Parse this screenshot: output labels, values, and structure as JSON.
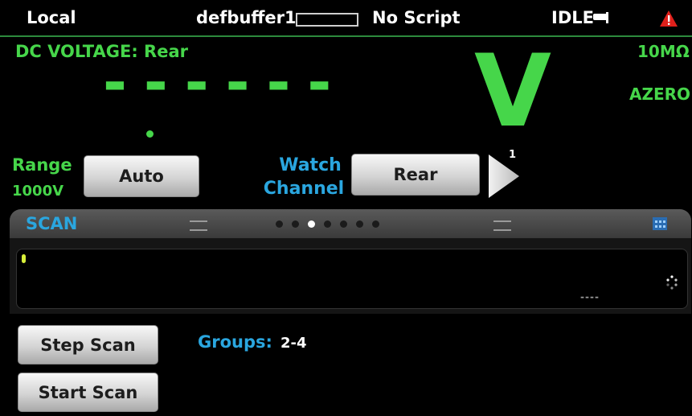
{
  "status_bar": {
    "location": "Local",
    "buffer": "defbuffer1",
    "script": "No Script",
    "state": "IDLE"
  },
  "reading": {
    "function_label": "DC VOLTAGE: Rear",
    "value": "------",
    "unit": "V",
    "input_impedance": "10MΩ",
    "autozero": "AZERO",
    "channel_superscript": "1"
  },
  "range": {
    "label": "Range",
    "value": "1000V",
    "button": "Auto"
  },
  "watch_channel": {
    "label_line1": "Watch",
    "label_line2": "Channel",
    "button": "Rear"
  },
  "scan": {
    "title": "SCAN",
    "status_text": "----",
    "step_button": "Step Scan",
    "start_button": "Start Scan",
    "groups_label": "Groups:",
    "groups_value": "2-4"
  },
  "swipe_pages": {
    "count": 7,
    "active_index": 2
  },
  "colors": {
    "accent_green": "#46d64a",
    "accent_blue": "#2aa6df",
    "warning_red": "#e0201b"
  }
}
